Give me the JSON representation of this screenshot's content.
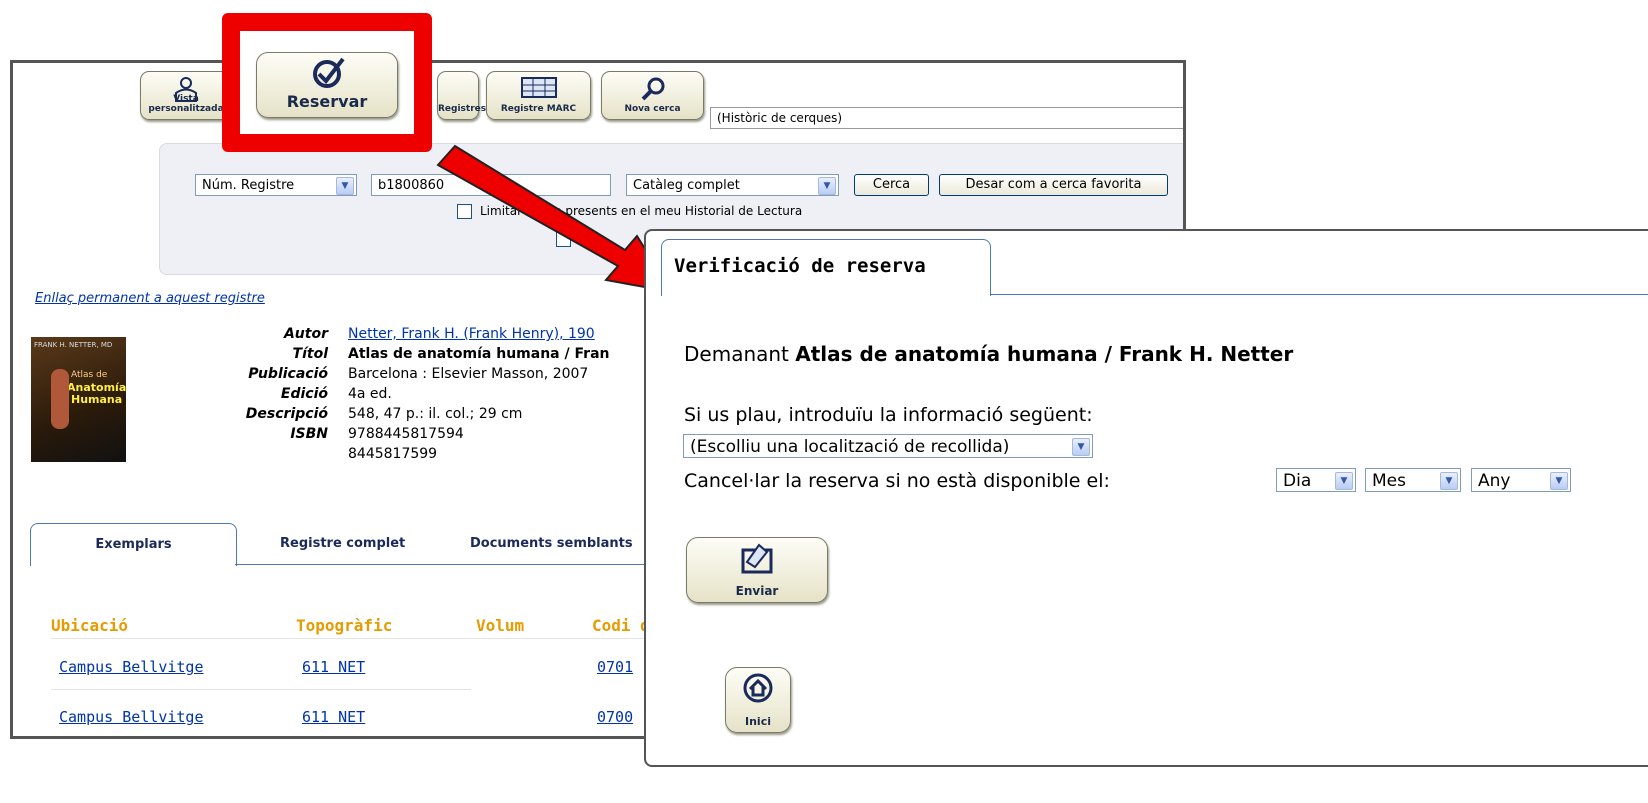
{
  "toolbar": {
    "vista": "Vista personalitzada",
    "reservar": "Reservar",
    "registres": "Registres",
    "marc": "Registre MARC",
    "nova": "Nova cerca",
    "history": "(Històric de cerques)"
  },
  "search": {
    "field": "Núm. Registre",
    "query": "b1800860",
    "scope": "Catàleg complet",
    "search_btn": "Cerca",
    "save_btn": "Desar com a cerca favorita",
    "limit_label": "Limitar als no presents en el meu Historial de Lectura"
  },
  "permalink": "Enllaç permanent a aquest registre",
  "cover": {
    "author": "FRANK H. NETTER, MD",
    "line1": "Atlas de",
    "line2": "Anatomía",
    "line3": "Humana"
  },
  "record": {
    "fields": [
      {
        "label": "Autor",
        "value": "Netter, Frank H. (Frank Henry), 190"
      },
      {
        "label": "Títol",
        "value": "Atlas de anatomía humana / Fran"
      },
      {
        "label": "Publicació",
        "value": "Barcelona : Elsevier Masson, 2007"
      },
      {
        "label": "Edició",
        "value": "4a ed."
      },
      {
        "label": "Descripció",
        "value": "548, 47 p.: il. col.; 29 cm"
      },
      {
        "label": "ISBN",
        "value": "9788445817594"
      },
      {
        "label": "",
        "value": "8445817599"
      }
    ]
  },
  "tabs": [
    "Exemplars",
    "Registre complet",
    "Documents semblants"
  ],
  "table": {
    "headers": [
      "Ubicació",
      "Topogràfic",
      "Volum",
      "Codi d"
    ],
    "rows": [
      [
        "Campus Bellvitge",
        "611 NET",
        "",
        "0701"
      ],
      [
        "Campus Bellvitge",
        "611 NET",
        "",
        "0700"
      ]
    ]
  },
  "dialog": {
    "title": "Verificació de reserva",
    "requesting_prefix": "Demanant",
    "requesting_title": "Atlas de anatomía humana / Frank H. Netter",
    "instructions": "Si us plau, introduïu la informació següent:",
    "location_select": "(Escolliu una localització de recollida)",
    "cancel_label": "Cancel·lar la reserva si no està disponible el:",
    "day": "Dia",
    "month": "Mes",
    "year": "Any",
    "submit": "Enviar",
    "home": "Inici"
  },
  "colors": {
    "highlight": "#ee0000",
    "header_orange": "#e69b00",
    "link": "#0033aa"
  }
}
